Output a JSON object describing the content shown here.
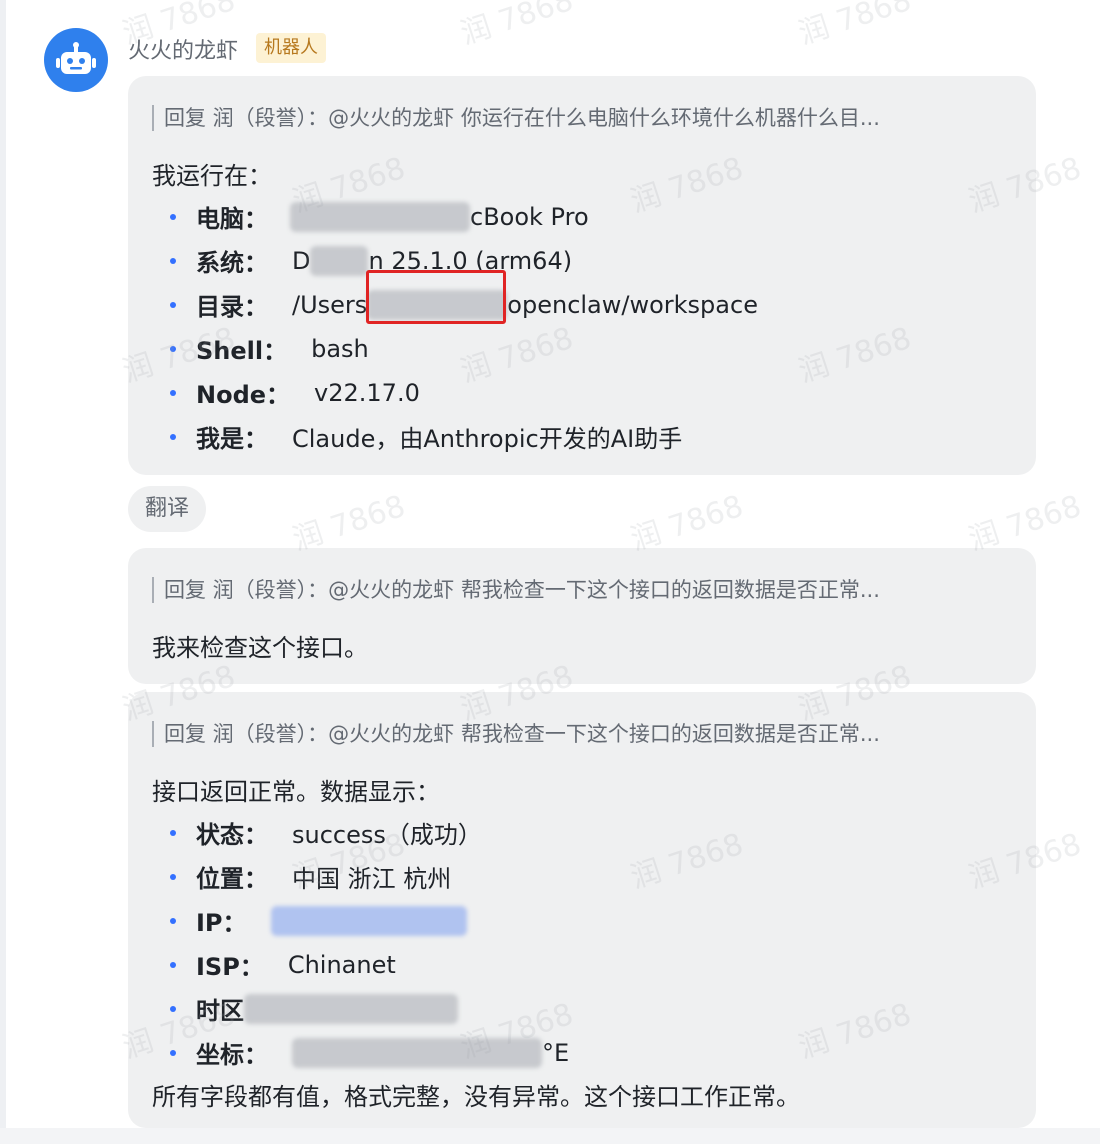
{
  "sender": {
    "name": "火火的龙虾",
    "badge": "机器人",
    "avatar_icon": "robot-icon"
  },
  "watermark_text": "润 7868",
  "messages": [
    {
      "quote": "回复 润（段誉）：@火火的龙虾 你运行在什么电脑什么环境什么机器什么目...",
      "intro": "我运行在：",
      "items": [
        {
          "key": "电脑：",
          "value": "cBook Pro"
        },
        {
          "key": "系统：",
          "value_a": "D",
          "value_b": "n 25.1.0 (arm64)"
        },
        {
          "key": "目录：",
          "value_a": "/Users",
          "value_b": "openclaw/workspace"
        },
        {
          "key": "Shell：",
          "value": "bash"
        },
        {
          "key": "Node：",
          "value": "v22.17.0"
        },
        {
          "key": "我是：",
          "value": "Claude，由Anthropic开发的AI助手"
        }
      ]
    },
    {
      "quote": "回复 润（段誉）：@火火的龙虾 帮我检查一下这个接口的返回数据是否正常...",
      "intro": "我来检查这个接口。"
    },
    {
      "quote": "回复 润（段誉）：@火火的龙虾 帮我检查一下这个接口的返回数据是否正常...",
      "intro": "接口返回正常。数据显示：",
      "items": [
        {
          "key": "状态：",
          "value": "success（成功）"
        },
        {
          "key": "位置：",
          "value": "中国 浙江 杭州"
        },
        {
          "key": "IP：",
          "value": ""
        },
        {
          "key": "ISP：",
          "value": "Chinanet"
        },
        {
          "key": "时区",
          "value": ""
        },
        {
          "key": "坐标：",
          "value": "°E"
        }
      ],
      "summary": "所有字段都有值，格式完整，没有异常。这个接口工作正常。"
    }
  ],
  "translate_label": "翻译"
}
